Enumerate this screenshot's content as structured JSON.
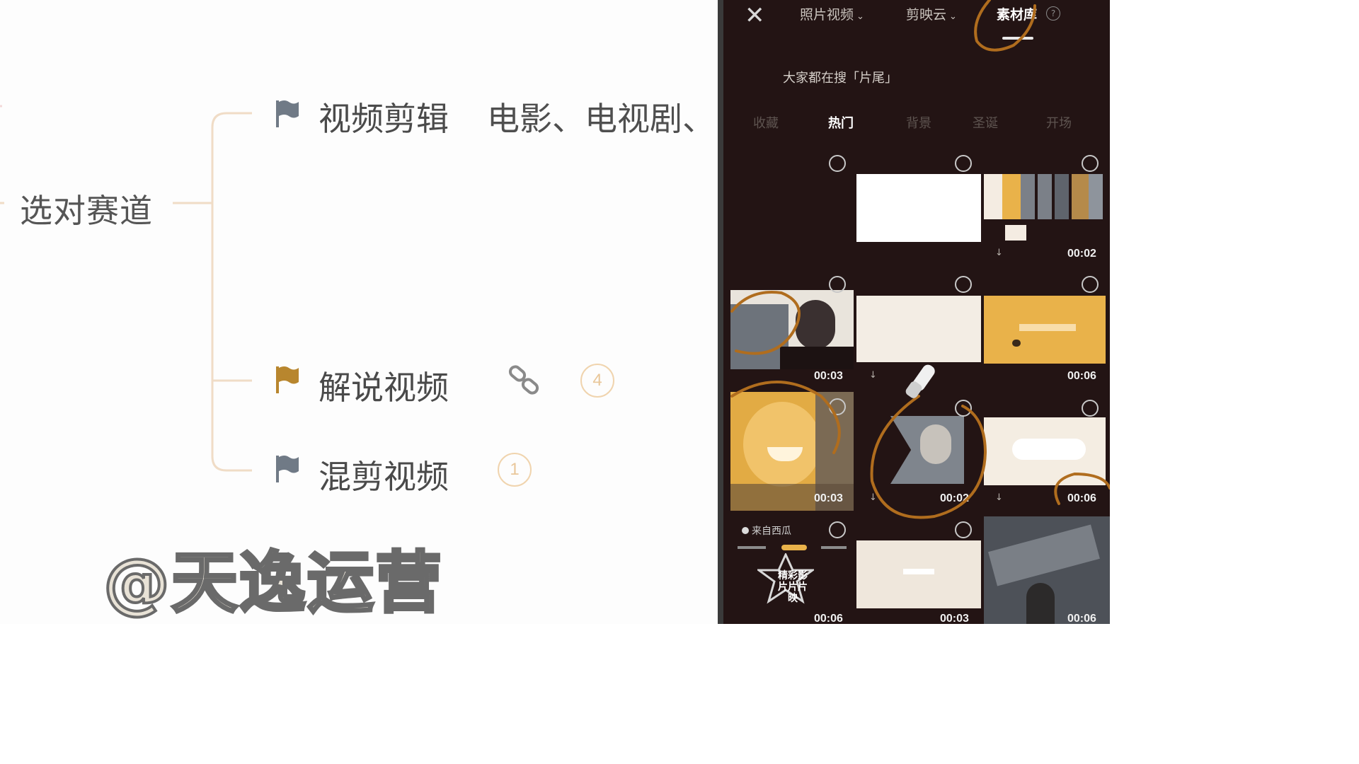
{
  "mindmap": {
    "root": "选对赛道",
    "branches": [
      {
        "label": "视频剪辑",
        "extra": "电影、电视剧、",
        "flag_color": "#707a86"
      },
      {
        "label": "解说视频",
        "badge": "4",
        "flag_color": "#b8862e"
      },
      {
        "label": "混剪视频",
        "badge": "1",
        "flag_color": "#707a86"
      }
    ],
    "link_icon": "link-icon"
  },
  "watermark": "@天逸运营",
  "phone": {
    "close_icon": "close-icon",
    "tabs": [
      {
        "label": "照片视频",
        "chevron": "⌄"
      },
      {
        "label": "剪映云",
        "chevron": "⌄"
      },
      {
        "label": "素材库",
        "active": true
      }
    ],
    "help": "?",
    "search_hint": "大家都在搜「片尾」",
    "categories": [
      "收藏",
      "热门",
      "背景",
      "圣诞",
      "开场"
    ],
    "active_category": "热门",
    "grid": {
      "durations": [
        "00:02",
        "00:03",
        "00:06",
        "00:03",
        "00:02",
        "00:06",
        "00:06",
        "00:03",
        "00:06"
      ],
      "xigua_label": "来自西瓜",
      "card_title": "精彩影片片片映"
    }
  },
  "colors": {
    "accent": "#e9b24a",
    "phone_bg": "#231414",
    "annotation": "#b06d1e"
  }
}
